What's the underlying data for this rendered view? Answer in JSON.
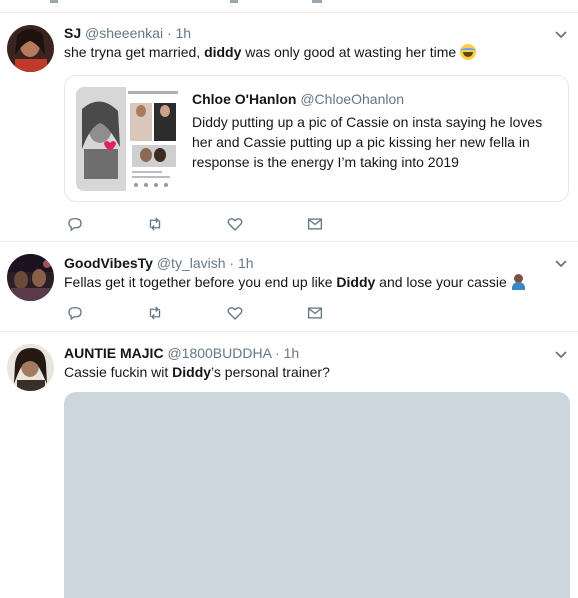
{
  "tweets": [
    {
      "name": "SJ",
      "handle": "@sheeenkai",
      "separator": "·",
      "time": "1h",
      "text_before": "she tryna get married, ",
      "text_bold": "diddy",
      "text_after": " was only good at wasting her time",
      "emoji": "face-with-tears-of-joy",
      "quote": {
        "name": "Chloe O'Hanlon",
        "handle": "@ChloeOhanlon",
        "text": "Diddy putting up a pic of Cassie on insta saying he loves her and Cassie putting up a pic kissing her new fella in response is the energy I’m taking into 2019"
      }
    },
    {
      "name": "GoodVibesTy",
      "handle": "@ty_lavish",
      "separator": "·",
      "time": "1h",
      "text_before": "Fellas get it together before you end up like ",
      "text_bold": "Diddy",
      "text_after": " and lose your cassie",
      "emoji": "person-shrugging"
    },
    {
      "name": "AUNTIE MAJIC",
      "handle": "@1800BUDDHA",
      "separator": "·",
      "time": "1h",
      "text_before": "Cassie fuckin wit ",
      "text_bold": "Diddy",
      "text_after": "’s personal trainer?"
    }
  ],
  "icons": {
    "reply": "reply-icon",
    "retweet": "retweet-icon",
    "like": "heart-icon",
    "dm": "envelope-icon",
    "more": "chevron-down-icon"
  },
  "colors": {
    "secondary": "#657786",
    "border": "#e6ecf0",
    "image_placeholder": "#ccd6dd"
  }
}
